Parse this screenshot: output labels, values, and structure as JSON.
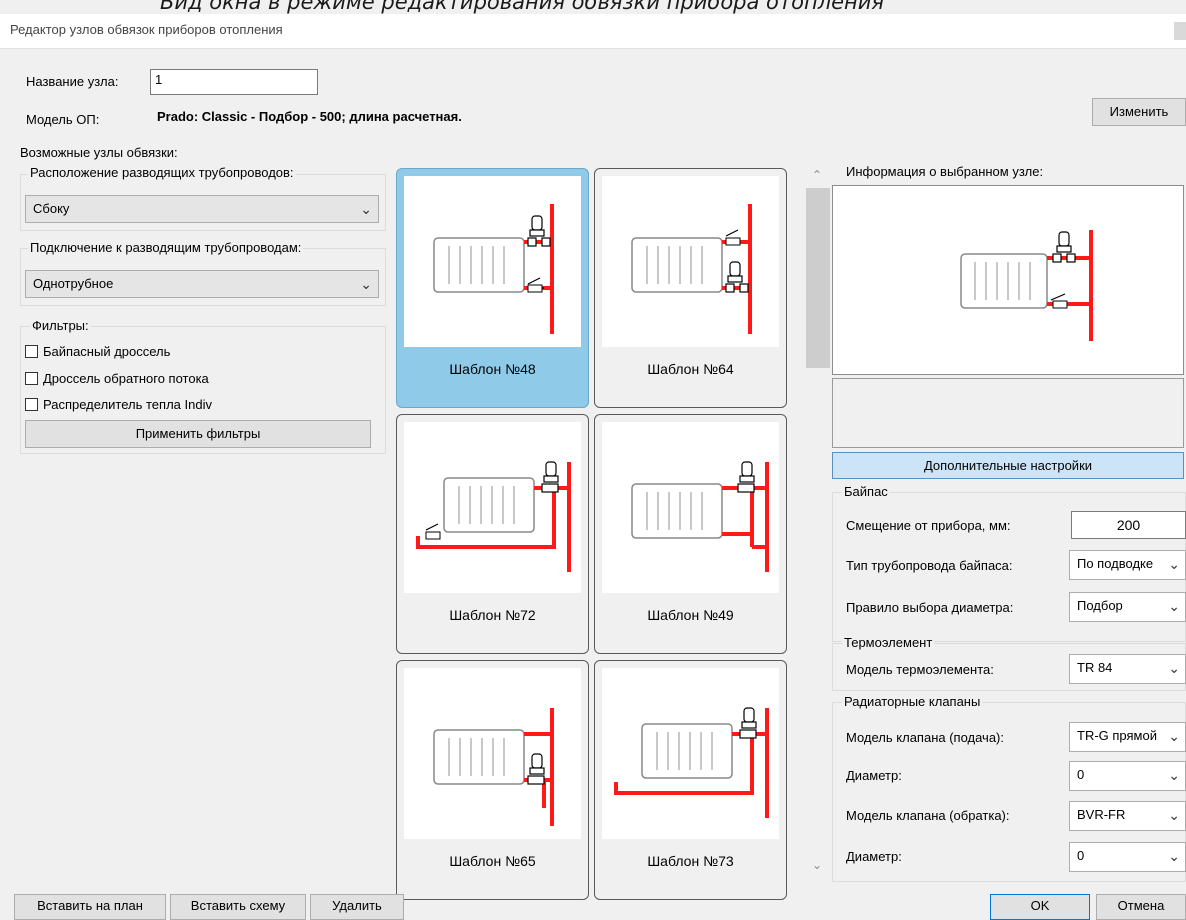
{
  "caption": "Вид окна в режиме редактирования обвязки прибора отопления",
  "window": {
    "title": "Редактор узлов обвязок приборов отопления"
  },
  "header": {
    "node_name_label": "Название узла:",
    "node_name_value": "1",
    "model_label": "Модель ОП:",
    "model_value": "Prado: Classic - Подбор - 500; длина расчетная.",
    "change_button": "Изменить"
  },
  "left": {
    "possible_nodes_label": "Возможные узлы обвязки:",
    "pipe_location_label": "Расположение разводящих трубопроводов:",
    "pipe_location_value": "Сбоку",
    "connection_label": "Подключение к разводящим трубопроводам:",
    "connection_value": "Однотрубное",
    "filters_label": "Фильтры:",
    "filters": [
      {
        "label": "Байпасный дроссель",
        "checked": false
      },
      {
        "label": "Дроссель обратного потока",
        "checked": false
      },
      {
        "label": "Распределитель тепла Indiv",
        "checked": false
      }
    ],
    "apply_filters_button": "Применить фильтры"
  },
  "templates": [
    {
      "label": "Шаблон №48",
      "selected": true
    },
    {
      "label": "Шаблон №64",
      "selected": false
    },
    {
      "label": "Шаблон №72",
      "selected": false
    },
    {
      "label": "Шаблон №49",
      "selected": false
    },
    {
      "label": "Шаблон №65",
      "selected": false
    },
    {
      "label": "Шаблон №73",
      "selected": false
    }
  ],
  "info": {
    "label": "Информация о выбранном узле:",
    "extra_settings_button": "Дополнительные настройки",
    "bypass_group": "Байпас",
    "offset_label": "Смещение от прибора, мм:",
    "offset_value": "200",
    "bypass_pipe_type_label": "Тип трубопровода байпаса:",
    "bypass_pipe_type_value": "По подводке",
    "diameter_rule_label": "Правило выбора диаметра:",
    "diameter_rule_value": "Подбор",
    "thermo_group": "Термоэлемент",
    "thermo_model_label": "Модель термоэлемента:",
    "thermo_model_value": "TR 84",
    "valves_group": "Радиаторные клапаны",
    "valve_supply_label": "Модель клапана (подача):",
    "valve_supply_value": "TR-G прямой",
    "diameter1_label": "Диаметр:",
    "diameter1_value": "0",
    "valve_return_label": "Модель клапана (обратка):",
    "valve_return_value": "BVR-FR",
    "diameter2_label": "Диаметр:",
    "diameter2_value": "0"
  },
  "footer": {
    "insert_plan": "Вставить на план",
    "insert_scheme": "Вставить схему",
    "delete": "Удалить",
    "ok": "OK",
    "cancel": "Отмена"
  },
  "colors": {
    "pipe": "#ff1a1a",
    "selected_tile": "#8fcbe8",
    "extra_button": "#cce4f7"
  }
}
